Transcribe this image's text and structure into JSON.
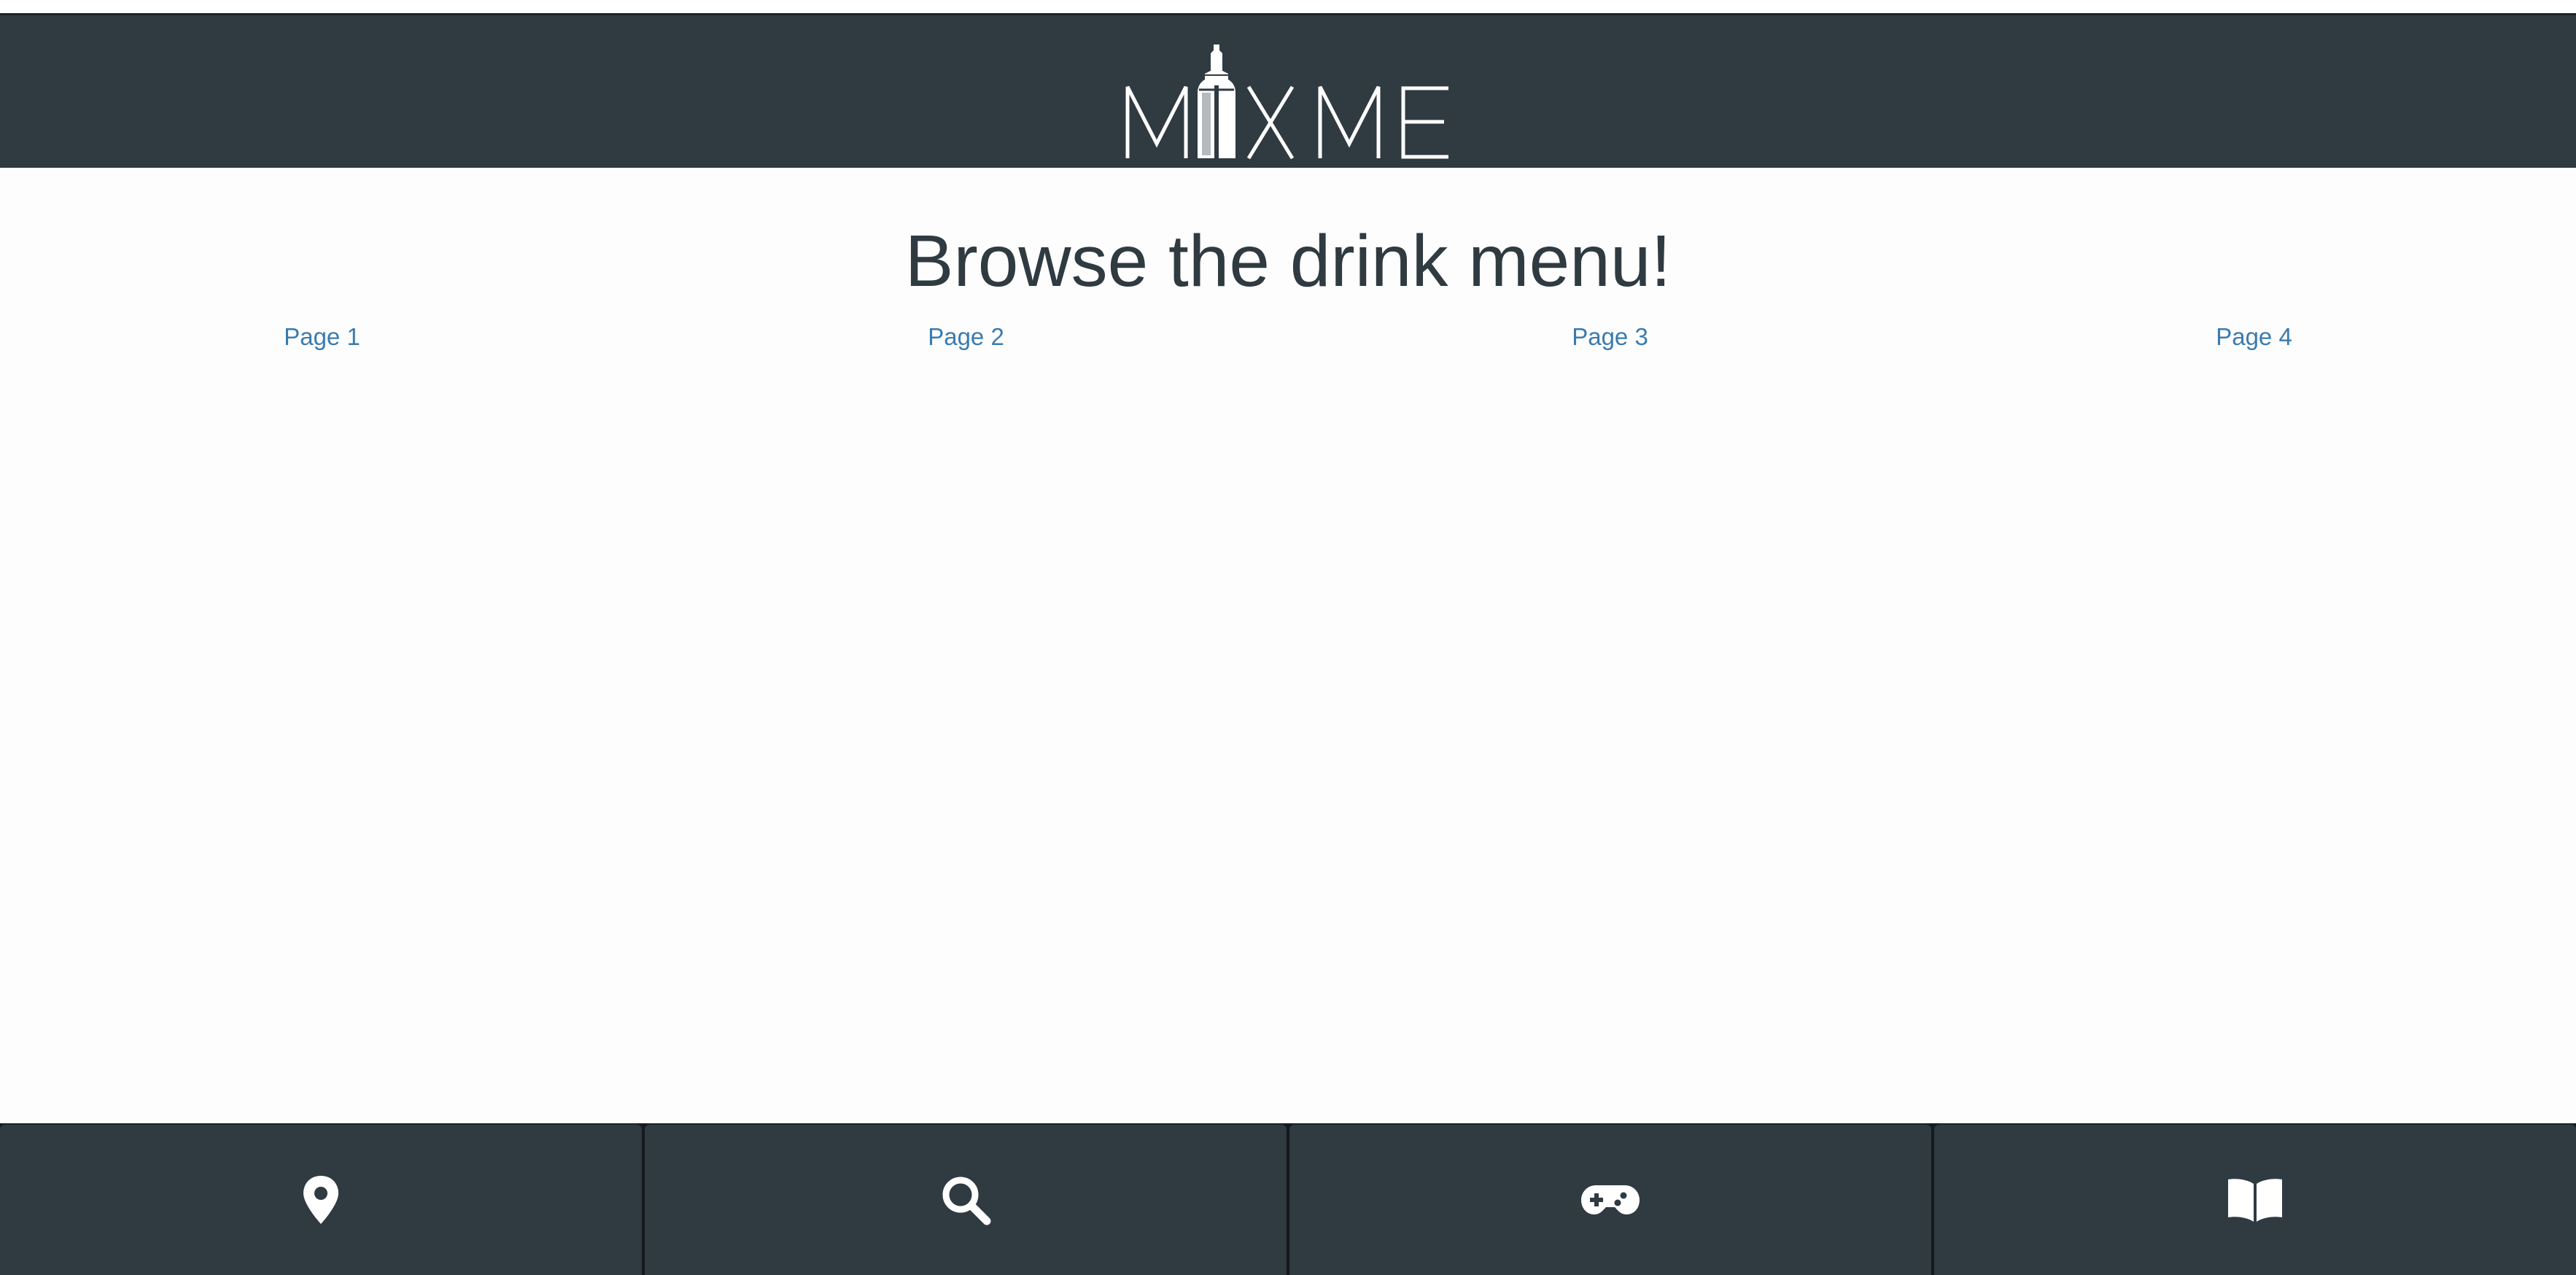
{
  "header": {
    "logo_text": "MIXME"
  },
  "main": {
    "title": "Browse the drink menu!",
    "pages": [
      {
        "label": "Page 1"
      },
      {
        "label": "Page 2"
      },
      {
        "label": "Page 3"
      },
      {
        "label": "Page 4"
      }
    ]
  },
  "bottom_nav": {
    "items": [
      {
        "icon": "map-marker-icon"
      },
      {
        "icon": "search-icon"
      },
      {
        "icon": "gamepad-icon"
      },
      {
        "icon": "book-icon"
      }
    ]
  },
  "colors": {
    "header_bg": "#2f3a41",
    "title": "#2f3a41",
    "link": "#3a7bb0",
    "icon": "#ffffff"
  }
}
